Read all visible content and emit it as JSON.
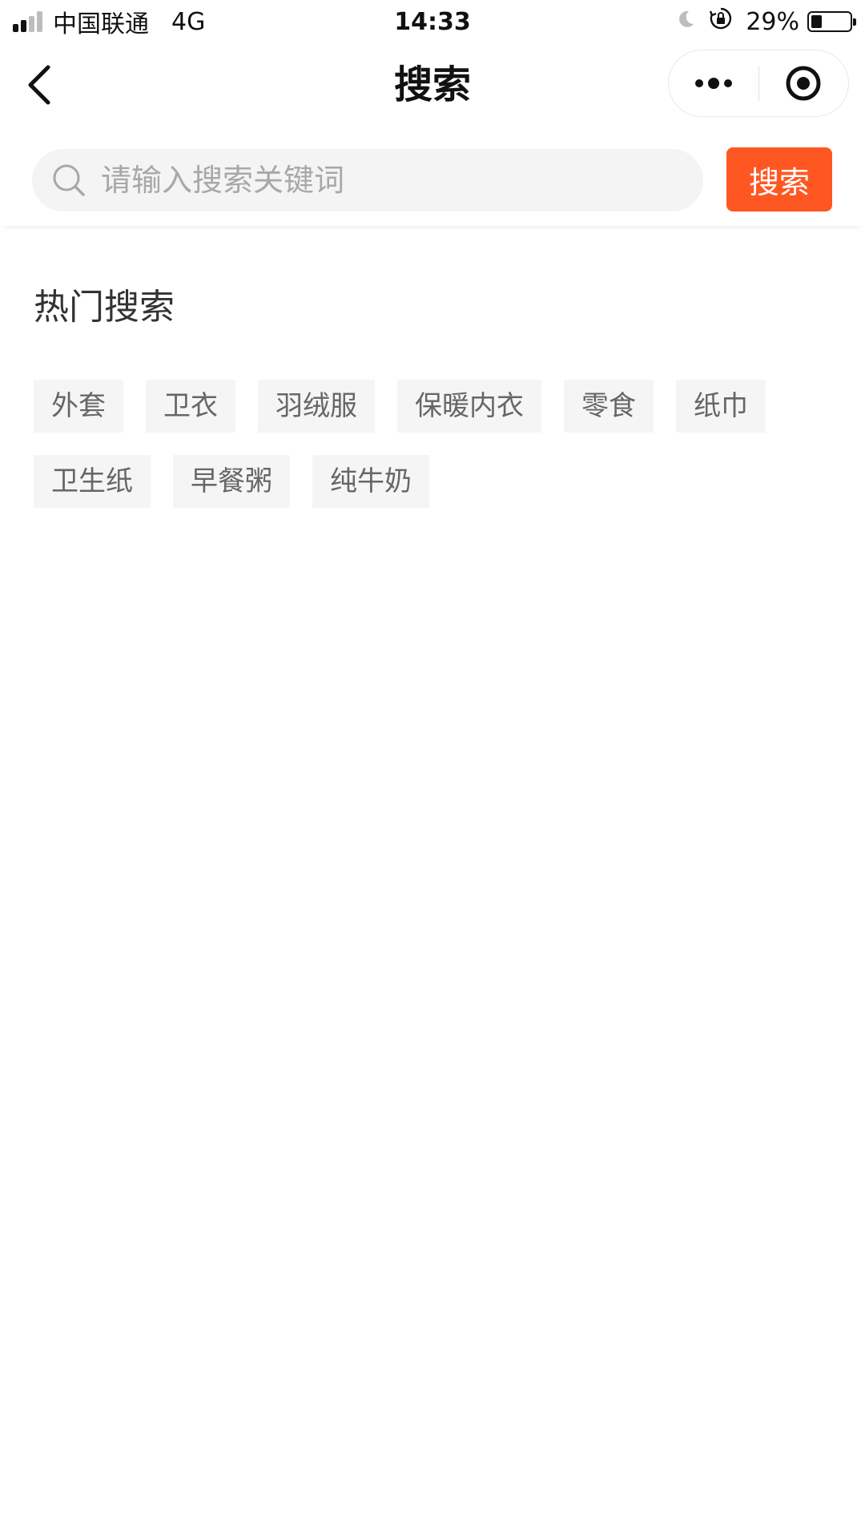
{
  "status_bar": {
    "carrier": "中国联通",
    "network": "4G",
    "time": "14:33",
    "battery_percent": "29%",
    "battery_level": 0.29
  },
  "nav": {
    "title": "搜索",
    "back_icon": "chevron-left-icon",
    "more_icon": "more-dots-icon",
    "close_icon": "target-circle-icon"
  },
  "search": {
    "placeholder": "请输入搜索关键词",
    "value": "",
    "button_label": "搜索",
    "accent_color": "#ff5722"
  },
  "hot_search": {
    "title": "热门搜索",
    "tags": [
      "外套",
      "卫衣",
      "羽绒服",
      "保暖内衣",
      "零食",
      "纸巾",
      "卫生纸",
      "早餐粥",
      "纯牛奶"
    ]
  }
}
